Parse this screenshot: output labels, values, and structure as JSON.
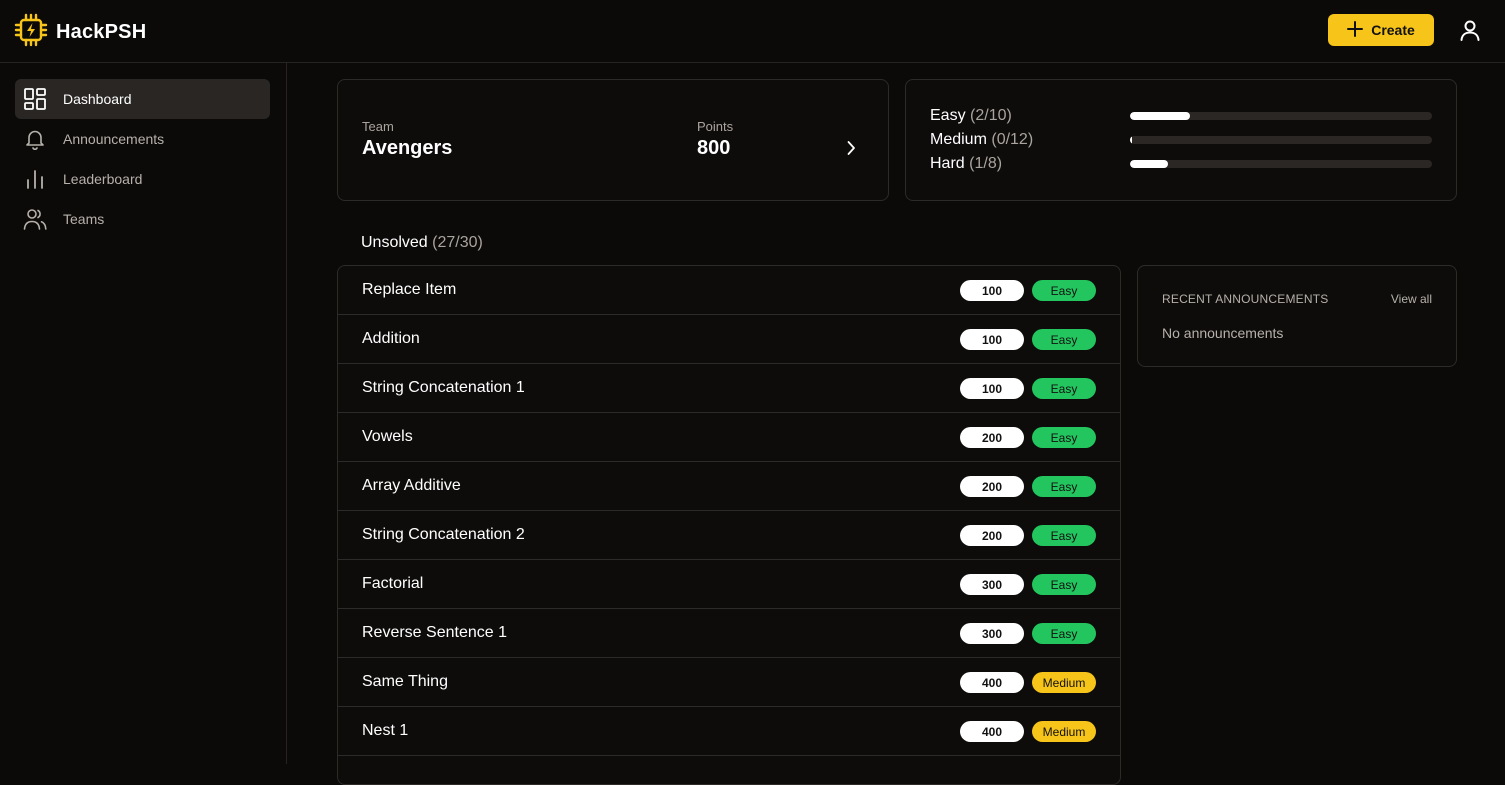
{
  "brand": {
    "name": "HackPSH",
    "accent": "#f7c41a"
  },
  "header": {
    "create_label": "Create"
  },
  "sidebar": {
    "items": [
      {
        "label": "Dashboard",
        "icon": "dashboard-icon",
        "active": true
      },
      {
        "label": "Announcements",
        "icon": "bell-icon"
      },
      {
        "label": "Leaderboard",
        "icon": "bar-chart-icon"
      },
      {
        "label": "Teams",
        "icon": "users-icon"
      }
    ]
  },
  "team": {
    "team_label": "Team",
    "team_name": "Avengers",
    "points_label": "Points",
    "points": "800"
  },
  "stats": [
    {
      "name": "Easy",
      "count": "(2/10)",
      "fraction": 0.2
    },
    {
      "name": "Medium",
      "count": "(0/12)",
      "fraction": 0.0
    },
    {
      "name": "Hard",
      "count": "(1/8)",
      "fraction": 0.125
    }
  ],
  "unsolved": {
    "label": "Unsolved",
    "count": "(27/30)"
  },
  "problems": [
    {
      "name": "Replace Item",
      "points": "100",
      "difficulty": "Easy"
    },
    {
      "name": "Addition",
      "points": "100",
      "difficulty": "Easy"
    },
    {
      "name": "String Concatenation 1",
      "points": "100",
      "difficulty": "Easy"
    },
    {
      "name": "Vowels",
      "points": "200",
      "difficulty": "Easy"
    },
    {
      "name": "Array Additive",
      "points": "200",
      "difficulty": "Easy"
    },
    {
      "name": "String Concatenation 2",
      "points": "200",
      "difficulty": "Easy"
    },
    {
      "name": "Factorial",
      "points": "300",
      "difficulty": "Easy"
    },
    {
      "name": "Reverse Sentence 1",
      "points": "300",
      "difficulty": "Easy"
    },
    {
      "name": "Same Thing",
      "points": "400",
      "difficulty": "Medium"
    },
    {
      "name": "Nest 1",
      "points": "400",
      "difficulty": "Medium"
    }
  ],
  "announcements": {
    "title": "RECENT ANNOUNCEMENTS",
    "view_all": "View all",
    "empty": "No announcements"
  }
}
